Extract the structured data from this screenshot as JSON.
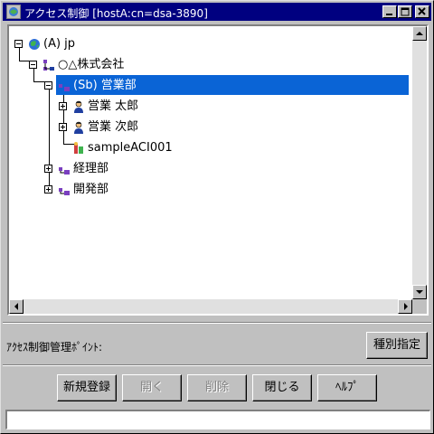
{
  "window": {
    "title": "アクセス制御 [hostA:cn=dsa-3890]",
    "controls": {
      "minimize_icon": "minimize-icon",
      "maximize_icon": "maximize-icon",
      "close_icon": "close-icon"
    }
  },
  "tree": {
    "nodes": [
      {
        "label": "(A) jp",
        "icon": "globe-icon",
        "expanded": true,
        "selected": false
      },
      {
        "label": "○△株式会社",
        "icon": "organization-icon",
        "expanded": true,
        "selected": false
      },
      {
        "label": "(Sb) 営業部",
        "icon": "org-unit-icon",
        "expanded": true,
        "selected": true
      },
      {
        "label": "営業 太郎",
        "icon": "person-icon",
        "expanded": false,
        "selected": false
      },
      {
        "label": "営業 次郎",
        "icon": "person-icon",
        "expanded": false,
        "selected": false
      },
      {
        "label": "sampleACI001",
        "icon": "aci-icon",
        "expanded": null,
        "selected": false
      },
      {
        "label": "経理部",
        "icon": "org-unit-icon",
        "expanded": false,
        "selected": false
      },
      {
        "label": "開発部",
        "icon": "org-unit-icon",
        "expanded": false,
        "selected": false
      }
    ],
    "colors": {
      "selection_bg": "#0a64d6",
      "selection_text": "#ffffff"
    }
  },
  "access_control_point": {
    "label": "ｱｸｾｽ制御管理ﾎﾟｲﾝﾄ:",
    "value": ""
  },
  "buttons": {
    "type_spec": "種別指定",
    "new_register": "新規登録",
    "open": "開く",
    "delete": "削除",
    "close": "閉じる",
    "help": "ﾍﾙﾌﾟ"
  },
  "statusbar": {
    "text": ""
  }
}
